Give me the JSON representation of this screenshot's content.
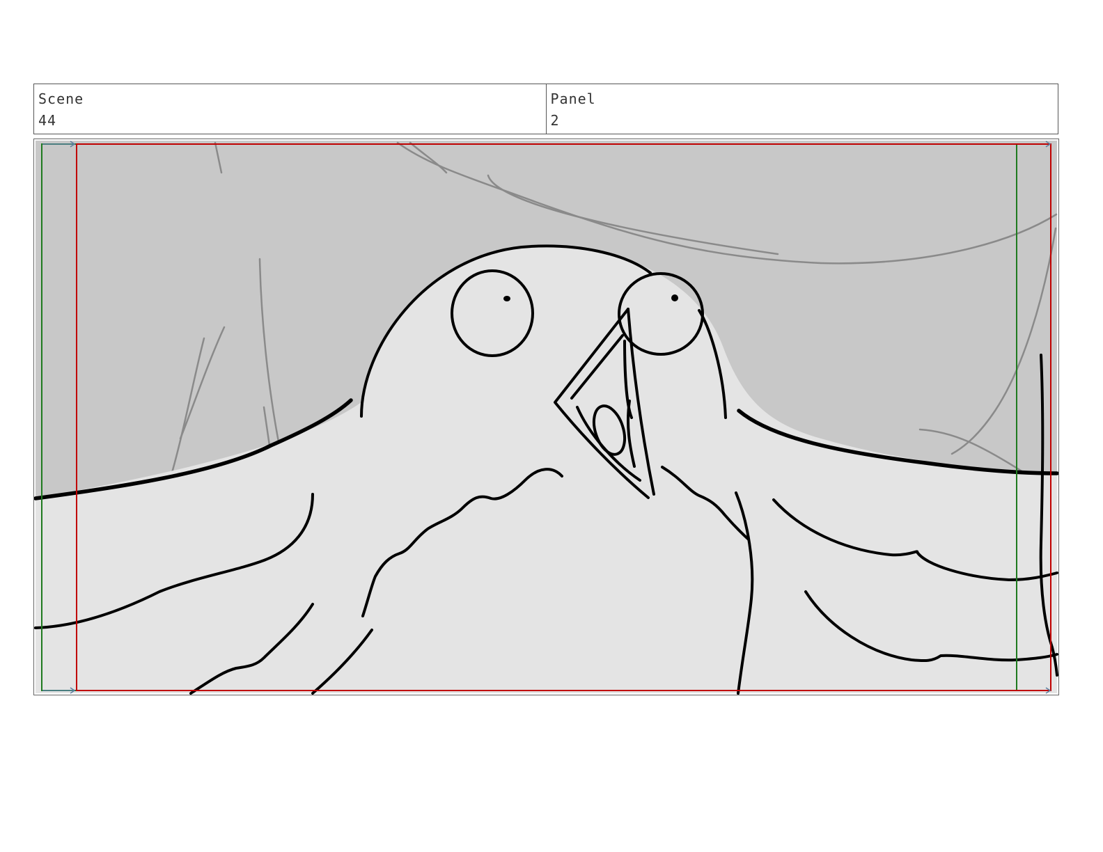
{
  "scene": {
    "label": "Scene",
    "value": "44"
  },
  "panel": {
    "label": "Panel",
    "value": "2"
  },
  "drawing": {
    "subject": "bird-with-open-beak",
    "colors": {
      "background_wall": "#c8c8c8",
      "bird_fill": "#e4e4e4",
      "ink": "#000000",
      "sketch_lines": "#8a8a8a",
      "title_safe": "#c00000",
      "action_safe": "#1f7a1f"
    }
  }
}
